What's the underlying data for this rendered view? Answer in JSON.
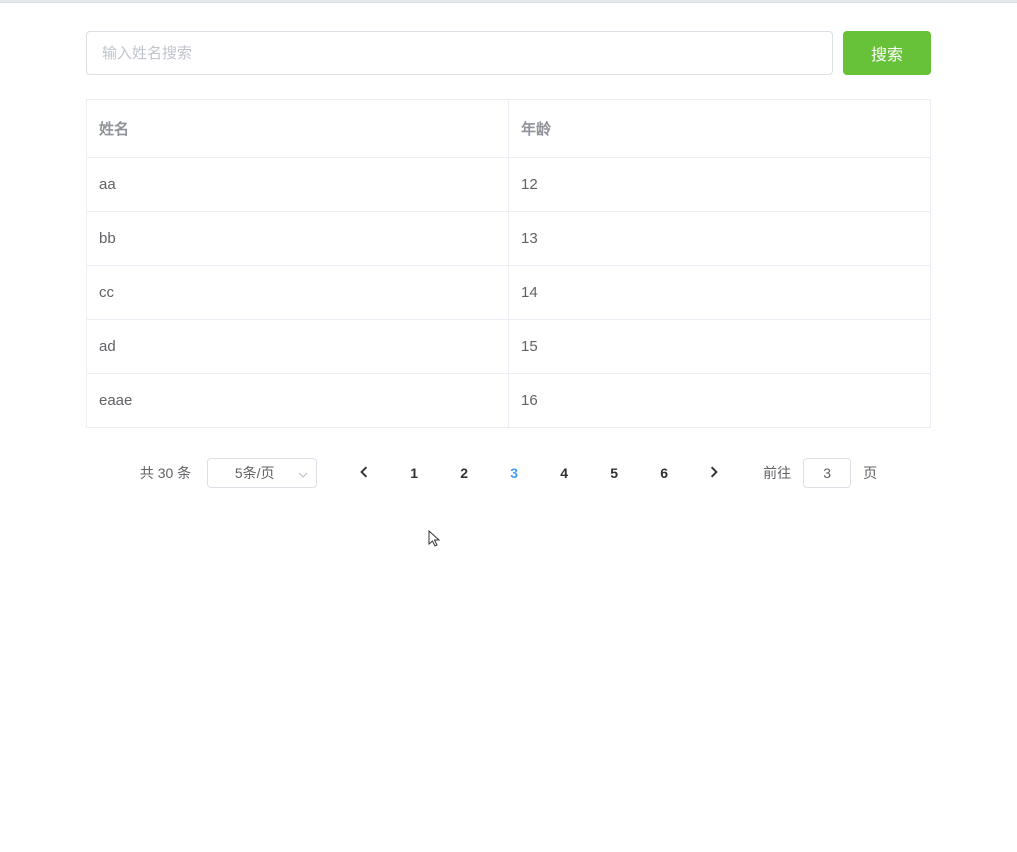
{
  "search": {
    "placeholder": "输入姓名搜索",
    "value": "",
    "button_label": "搜索"
  },
  "table": {
    "columns": [
      "姓名",
      "年龄"
    ],
    "rows": [
      {
        "name": "aa",
        "age": "12"
      },
      {
        "name": "bb",
        "age": "13"
      },
      {
        "name": "cc",
        "age": "14"
      },
      {
        "name": "ad",
        "age": "15"
      },
      {
        "name": "eaae",
        "age": "16"
      }
    ]
  },
  "pagination": {
    "total_prefix": "共",
    "total_count": "30",
    "total_suffix": "条",
    "page_size_label": "5条/页",
    "pages": [
      "1",
      "2",
      "3",
      "4",
      "5",
      "6"
    ],
    "current_page": "3",
    "jump_prefix": "前往",
    "jump_value": "3",
    "jump_suffix": "页"
  }
}
